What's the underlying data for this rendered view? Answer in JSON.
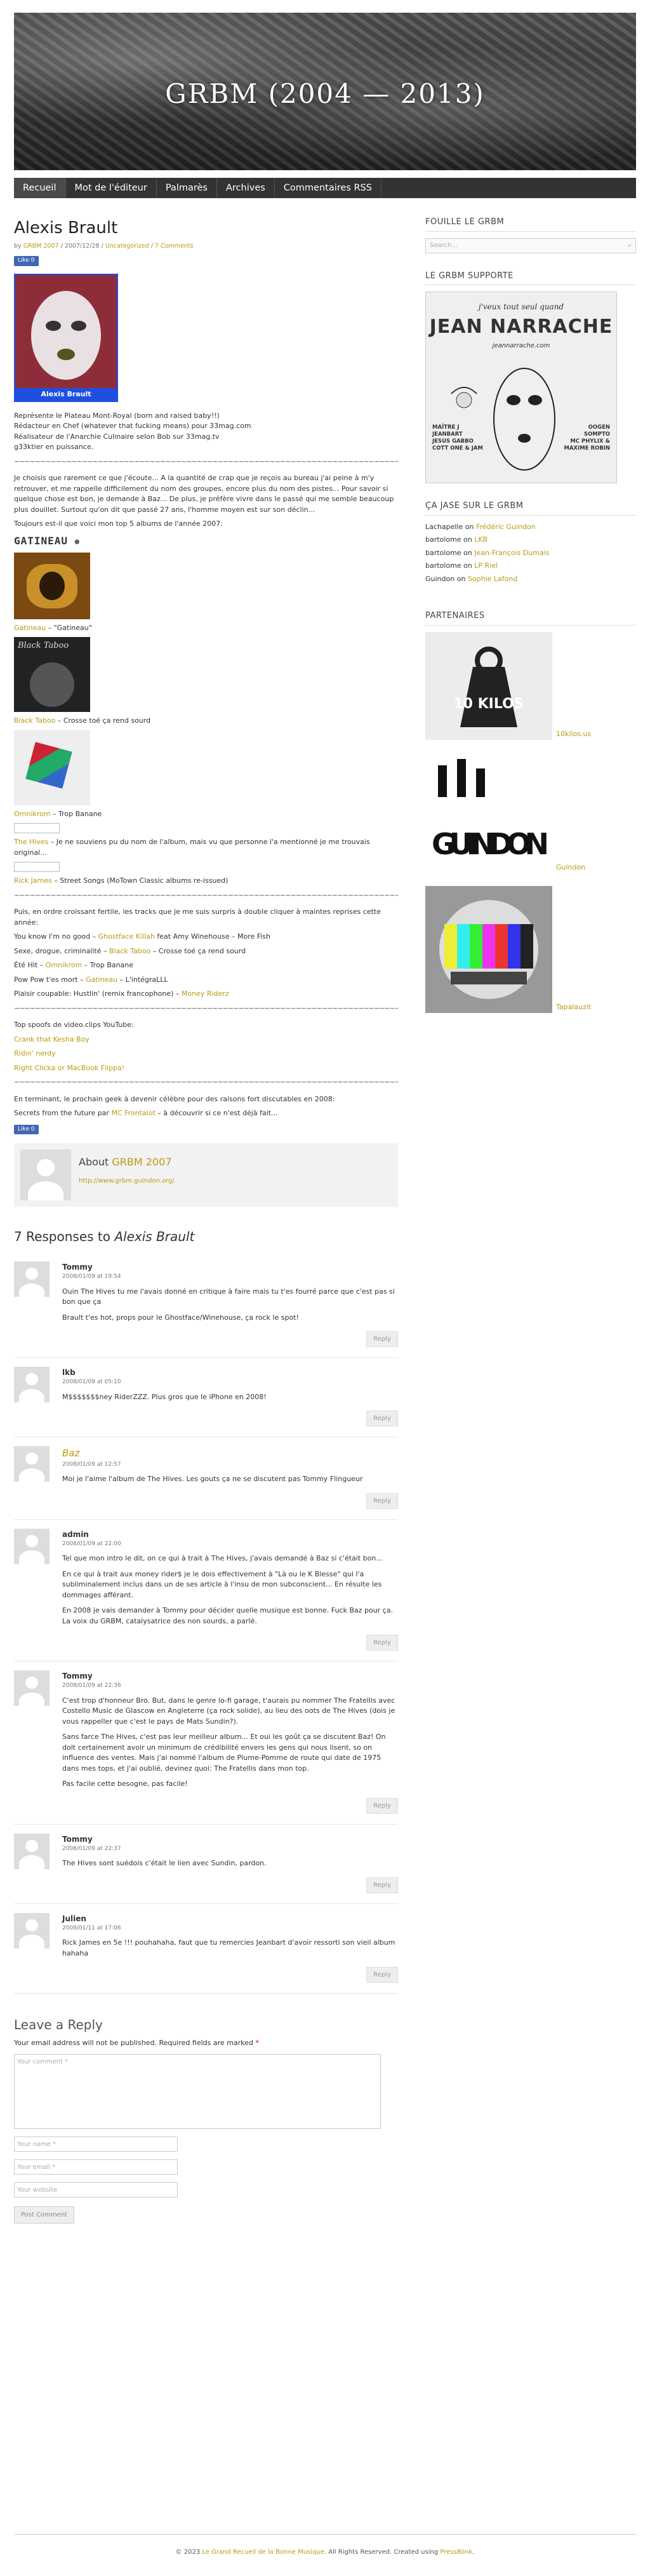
{
  "site": {
    "title": "GRBM (2004 — 2013)"
  },
  "nav": [
    "Recueil",
    "Mot de l'éditeur",
    "Palmarès",
    "Archives",
    "Commentaires RSS"
  ],
  "post": {
    "title": "Alexis Brault",
    "meta_by": "by",
    "author": "GRBM 2007",
    "date": "2007/12/28",
    "category": "Uncategorized",
    "comments_link": "7 Comments",
    "like": "Like 0",
    "photo_caption": "Alexis Brault",
    "intro": [
      "Représente le Plateau Mont-Royal (born and raised baby!!)",
      "Rédacteur en Chef (whatever that fucking means) pour 33mag.com",
      "Réalisateur de l'Anarchie Culinaire selon Bob sur 33mag.tv",
      "g33ktier en puissance."
    ],
    "sep": "~~~~~~~~~~~~~~~~~~~~~~~~~~~~~~~~~~~~~~~~~~~~~~~~~~~~~~~~~~~~~~~~~~~~~~~~~~~~~~~~~~~~~",
    "para1": "Je choisis que rarement ce que j'écoute... A la quantité de crap que je reçois au bureau j'ai peine à m'y retrouver, et me rappelle difficilement du nom des groupes, encore plus du nom des pistes... Pour savoir si quelque chose est bon, je demande à Baz... De plus, je préfère vivre dans le passé qui me semble beaucoup plus douillet. Surtout qu'on dit que passé 27 ans, l'homme moyen est sur son déclin...",
    "para2": "Toujours est-il que voici mon top 5 albums de l'année 2007:",
    "gatineau_logo": "GATINEAU",
    "albums": [
      {
        "artist": "Gatineau",
        "rest": " – \"Gatineau\""
      },
      {
        "artist": "Black Taboo",
        "rest": " – Crosse toé ça rend sourd"
      },
      {
        "artist": "Omnikrom",
        "rest": " – Trop Banane"
      },
      {
        "artist": "The Hives",
        "rest": " – Je ne souviens pu du nom de l'album, mais vu que personne l'a mentionné je me trouvais original..."
      },
      {
        "artist": "Rick James",
        "rest": " – Street Songs (MoTown Classic albums re-issued)"
      }
    ],
    "black_taboo_text": "Black Taboo",
    "para3": "Puis, en ordre croissant fertile, les tracks que je me suis surpris à double cliquer à maintes reprises cette année:",
    "tracks": [
      {
        "pre": "You know I'm no good – ",
        "link": "Ghostface Killah",
        "post": " feat Amy Winehouse – More Fish"
      },
      {
        "pre": "Sexe, drogue, criminalité – ",
        "link": "Black Taboo",
        "post": " – Crosse toé ça rend sourd"
      },
      {
        "pre": "Été Hit – ",
        "link": "Omnikrom",
        "post": " – Trop Banane"
      },
      {
        "pre": "Pow Pow t'es mort – ",
        "link": "Gatineau",
        "post": " – L'intégraLLL"
      },
      {
        "pre": "Plaisir coupable: Hustlin' (remix francophone) – ",
        "link": "Money Riderz",
        "post": ""
      }
    ],
    "para4": "Top spoofs de video.clips YouTube:",
    "spoofs": [
      "Crank that Kesha Boy",
      "Ridin' nerdy",
      "Right Clicka or MacBook Flippa!"
    ],
    "para5": "En terminant, le prochain geek à devenir célèbre pour des raisons fort discutables en 2008:",
    "para6_pre": "Secrets from the future par ",
    "para6_link": "MC Frontalot",
    "para6_post": " – à découvrir si ce n'est déjà fait...",
    "like2": "Like 0"
  },
  "about": {
    "label": "About",
    "name": "GRBM 2007",
    "url": "http://www.grbm.guindon.org/"
  },
  "responses": {
    "count_text": "7 Responses to ",
    "title": "Alexis Brault"
  },
  "comments": [
    {
      "author": "Tommy",
      "date": "2008/01/09 at 19:54",
      "italic": false,
      "paras": [
        "Ouin The Hives tu me l'avais donné en critique à faire mais tu t'es fourré parce que c'est pas si bon que ça",
        "Brault t'es hot, props pour le Ghostface/Winehouse, ça rock le spot!"
      ]
    },
    {
      "author": "lkb",
      "date": "2008/01/09 at 05:10",
      "italic": false,
      "paras": [
        "M$$$$$$$ney RiderZZZ. Plus gros que le iPhone en 2008!"
      ]
    },
    {
      "author": "Baz",
      "date": "2008/01/09 at 12:57",
      "italic": true,
      "paras": [
        "Moi je l'aime l'album de The Hives. Les gouts ça ne se discutent pas Tommy Flingueur"
      ]
    },
    {
      "author": "admin",
      "date": "2008/01/09 at 22:00",
      "italic": false,
      "paras": [
        "Tel que mon intro le dit, on ce qui à trait à The Hives, j'avais demandé à Baz si c'était bon...",
        "En ce qui à trait aux money rider$ je le dois effectivement à \"Là ou le K Blesse\" qui l'a subliminalement inclus dans un de ses article à l'insu de mon subconscient... En résulte les dommages afférant.",
        "En 2008 je vais demander à Tommy pour décider quelle musique est bonne. Fuck Baz pour ça. La voix du GRBM, catalysatrice des non sourds, a parlé."
      ]
    },
    {
      "author": "Tommy",
      "date": "2008/01/09 at 22:36",
      "italic": false,
      "paras": [
        "C'est trop d'honneur Bro. But, dans le genre lo-fi garage, t'aurais pu nommer The Fratellis avec Costello Music de Glascow en Angleterre (ça rock solide), au lieu des oots de The Hives (dois je vous rappeller que c'est le pays de Mats Sundin?).",
        "Sans farce The Hives, c'est pas leur meilleur album... Et oui les goût ça se discutent Baz! On doit certainement avoir un minimum de crédibilité envers les gens qui nous lisent, so on influence des ventes. Mais j'ai nommé l'album de Plume-Pomme de route qui date de 1975 dans mes tops, et j'ai oublié, devinez quoi: The Fratellis dans mon top.",
        "Pas facile cette besogne, pas facile!"
      ]
    },
    {
      "author": "Tommy",
      "date": "2008/01/09 at 22:37",
      "italic": false,
      "paras": [
        "The Hives sont suédois c'était le lien avec Sundin, pardon."
      ]
    },
    {
      "author": "Julien",
      "date": "2008/01/11 at 17:06",
      "italic": false,
      "paras": [
        "Rick James en 5e !!! pouhahaha, faut que tu remercies Jeanbart d'avoir ressorti son vieil album hahaha"
      ]
    }
  ],
  "reply_label": "Reply",
  "leave_reply": {
    "title": "Leave a Reply",
    "note": "Your email address will not be published. Required fields are marked ",
    "star": "*",
    "comment_ph": "Your comment *",
    "name_ph": "Your name *",
    "email_ph": "Your email *",
    "website_ph": "Your website",
    "post_button": "Post Comment"
  },
  "sidebar": {
    "search_title": "FOUILLE LE GRBM",
    "search_ph": "Search...",
    "support_title": "LE GRBM SUPPORTE",
    "support_ad": {
      "line1": "j'veux tout seul quand",
      "line2": "JEAN NARRACHE",
      "site": "jeannarrache.com",
      "left": "MAÎTRE J\nJEANBART\nJESUS GABBO\nCOTT ONE & JAM",
      "right": "OOGEN\nSOMPTO\nMC PHYLIX &\nMAXIME ROBIN"
    },
    "recent_title": "ÇA JASE SUR LE GRBM",
    "recent": [
      {
        "who": "Lachapelle",
        "on": " on ",
        "link": "Frédéric Guindon"
      },
      {
        "who": "bartolome",
        "on": " on ",
        "link": "LKB"
      },
      {
        "who": "bartolome",
        "on": " on ",
        "link": "Jean-François Dumais"
      },
      {
        "who": "bartolome",
        "on": " on ",
        "link": "LP Riel"
      },
      {
        "who": "Guindon",
        "on": " on ",
        "link": "Sophie Lafond"
      }
    ],
    "partners_title": "PARTENAIRES",
    "partners": [
      {
        "label": "10kilos.us",
        "img": "10 KILOS"
      },
      {
        "label": "Guindon",
        "img": "GUINDON"
      },
      {
        "label": "Tapalauzit",
        "img": ""
      }
    ]
  },
  "footer": {
    "pre": "© 2023 ",
    "link": "Le Grand Recueil de la Bonne Musique",
    "mid": ". All Rights Reserved. Created using ",
    "link2": "PressBlink",
    "end": "."
  },
  "colors": {
    "link": "#b89a12",
    "nav_bg": "#333333"
  }
}
